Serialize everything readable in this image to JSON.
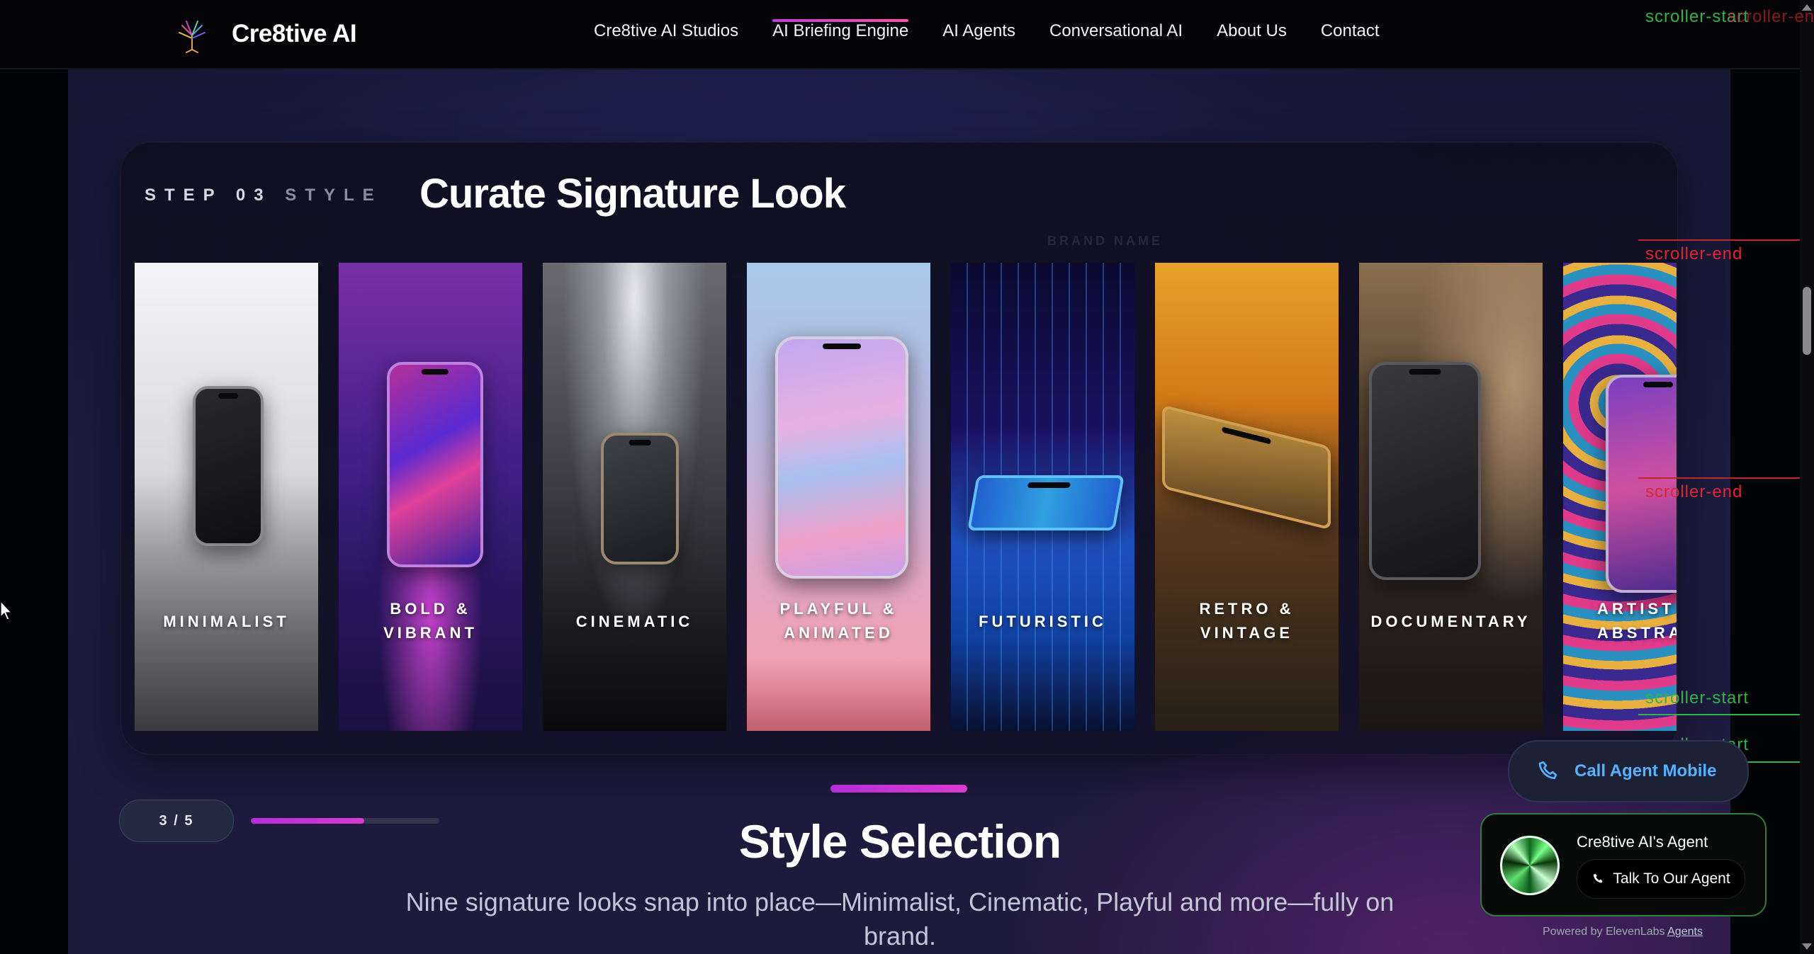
{
  "nav": {
    "brand": "Cre8tive AI",
    "links": [
      "Cre8tive AI Studios",
      "AI Briefing Engine",
      "AI Agents",
      "Conversational AI",
      "About Us",
      "Contact"
    ],
    "active_index": 1
  },
  "card": {
    "step_number": "STEP 03",
    "step_name": "STYLE",
    "title": "Curate Signature Look",
    "faint_text_1": "BRAND NAME"
  },
  "styles": [
    {
      "label": "MINIMALIST"
    },
    {
      "label": "BOLD &\nVIBRANT"
    },
    {
      "label": "CINEMATIC"
    },
    {
      "label": "PLAYFUL &\nANIMATED"
    },
    {
      "label": "FUTURISTIC"
    },
    {
      "label": "RETRO &\nVINTAGE"
    },
    {
      "label": "DOCUMENTARY"
    },
    {
      "label": "ARTIST\nABSTRA"
    }
  ],
  "progress": {
    "text": "3 / 5",
    "fraction": 0.6
  },
  "section": {
    "title": "Style Selection",
    "description": "Nine signature looks snap into place—Minimalist, Cinematic, Playful and more—fully on brand."
  },
  "markers": {
    "start": "scroller-start",
    "end": "scroller-end"
  },
  "call_mobile": {
    "label": "Call Agent Mobile"
  },
  "agent": {
    "name": "Cre8tive AI's Agent",
    "button": "Talk To Our Agent",
    "powered_prefix": "Powered by ElevenLabs",
    "powered_link": "Agents"
  },
  "colors": {
    "accent": "#c23bd6",
    "agent_border": "#2e7d3a",
    "call_text": "#53b3ff"
  }
}
